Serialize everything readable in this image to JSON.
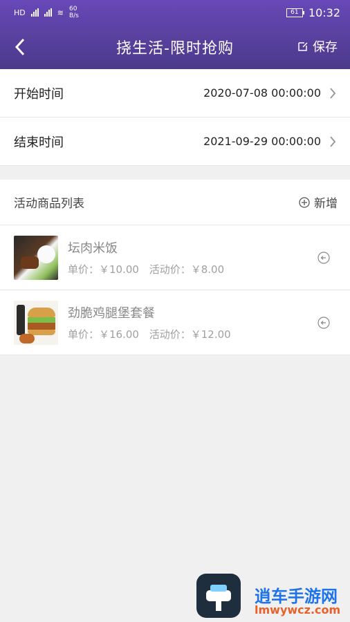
{
  "status": {
    "signal": "46",
    "speed": "60\nB/s",
    "battery": "61",
    "time": "10:32"
  },
  "nav": {
    "title": "挠生活-限时抢购",
    "save_label": "保存"
  },
  "time_rows": [
    {
      "label": "开始时间",
      "value": "2020-07-08 00:00:00"
    },
    {
      "label": "结束时间",
      "value": "2021-09-29 00:00:00"
    }
  ],
  "goods": {
    "section_title": "活动商品列表",
    "add_label": "新增",
    "items": [
      {
        "name": "坛肉米饭",
        "unit_price": "单价：￥10.00",
        "activity_price": "活动价：￥8.00"
      },
      {
        "name": "劲脆鸡腿堡套餐",
        "unit_price": "单价：￥16.00",
        "activity_price": "活动价：￥12.00"
      }
    ]
  },
  "watermark": {
    "name": "逍车手游网",
    "url": "lmwywcz.com"
  },
  "colors": {
    "header_top": "#6848b8",
    "header_bottom": "#4b3a8a",
    "background": "#f0f0f0"
  }
}
